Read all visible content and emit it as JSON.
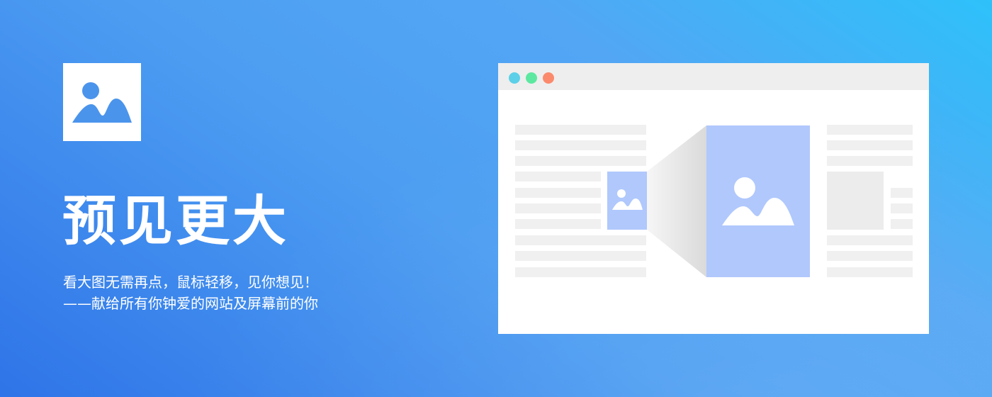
{
  "headline": "预见更大",
  "subtitle_line1": "看大图无需再点，鼠标轻移，见你想见！",
  "subtitle_line2": "——献给所有你钟爱的网站及屏幕前的你",
  "icons": {
    "logo": "image-icon",
    "thumbnail": "image-icon",
    "preview": "image-icon"
  },
  "colors": {
    "background_start": "#2f74e8",
    "background_end": "#2ec1fa",
    "image_placeholder": "#b0c8fc",
    "logo_icon": "#4b94ec",
    "window_dots": [
      "#5bd0e8",
      "#5ce8a0",
      "#fb8a6c"
    ]
  }
}
